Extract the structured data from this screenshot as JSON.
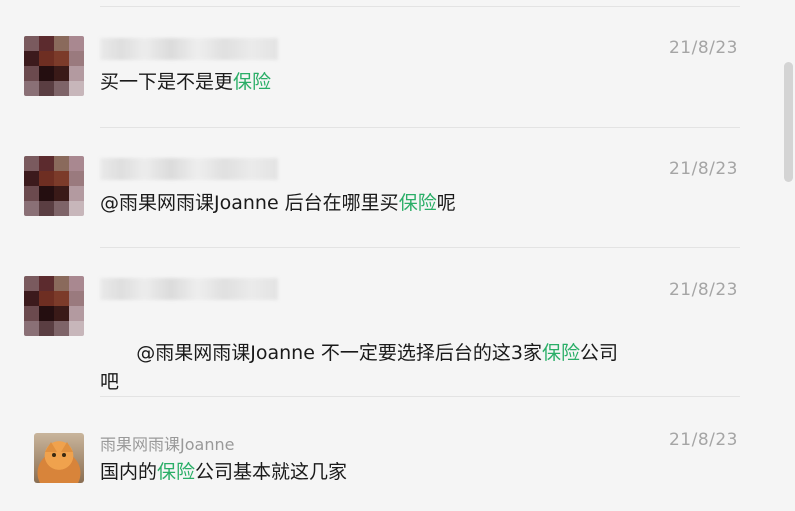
{
  "keyword_color": "#2aae67",
  "messages": [
    {
      "time": "21/8/23",
      "parts": [
        {
          "text": "买一下是不是更",
          "hl": false
        },
        {
          "text": "保险",
          "hl": true
        }
      ]
    },
    {
      "time": "21/8/23",
      "parts": [
        {
          "text": "@雨果网雨课Joanne 后台在哪里买",
          "hl": false
        },
        {
          "text": "保险",
          "hl": true
        },
        {
          "text": "呢",
          "hl": false
        }
      ]
    },
    {
      "time": "21/8/23",
      "parts": [
        {
          "text": "@雨果网雨课Joanne 不一定要选择后台的这3家",
          "hl": false
        },
        {
          "text": "保险",
          "hl": true
        },
        {
          "text": "公司",
          "hl": false
        },
        {
          "text": "\n吧",
          "hl": false
        }
      ]
    },
    {
      "name": "雨果网雨课Joanne",
      "time": "21/8/23",
      "parts": [
        {
          "text": "国内的",
          "hl": false
        },
        {
          "text": "保险",
          "hl": true
        },
        {
          "text": "公司基本就这几家",
          "hl": false
        }
      ]
    }
  ]
}
